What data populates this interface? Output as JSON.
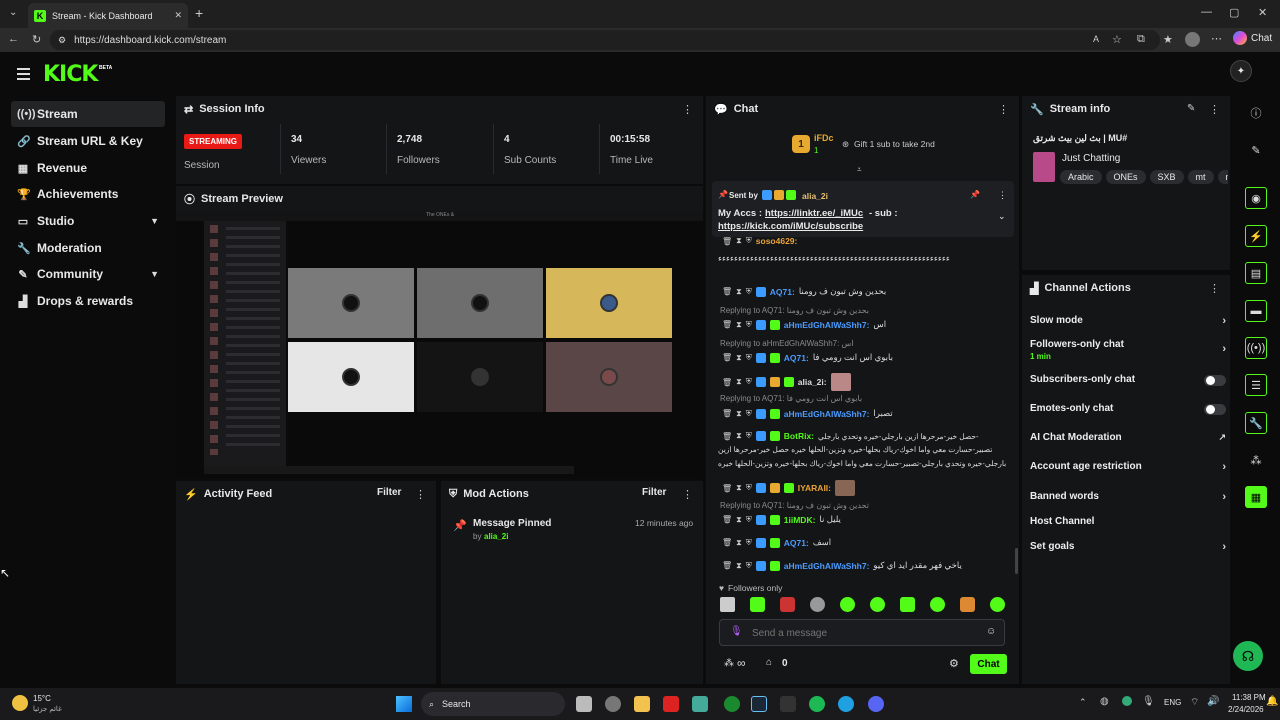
{
  "browser": {
    "tab_title": "Stream - Kick Dashboard",
    "url": "https://dashboard.kick.com/stream",
    "chat_button": "Chat"
  },
  "app": {
    "logo": "KICK",
    "beta": "BETA"
  },
  "sidebar": {
    "items": [
      {
        "label": "Stream",
        "icon": "stream-icon"
      },
      {
        "label": "Stream URL & Key",
        "icon": "link-icon"
      },
      {
        "label": "Revenue",
        "icon": "revenue-icon"
      },
      {
        "label": "Achievements",
        "icon": "trophy-icon"
      },
      {
        "label": "Studio",
        "icon": "studio-icon"
      },
      {
        "label": "Moderation",
        "icon": "wrench-icon"
      },
      {
        "label": "Community",
        "icon": "community-icon"
      },
      {
        "label": "Drops & rewards",
        "icon": "drops-icon"
      }
    ]
  },
  "session": {
    "title": "Session Info",
    "status": "STREAMING",
    "status_label": "Session",
    "stats": [
      {
        "value": "34",
        "label": "Viewers"
      },
      {
        "value": "2,748",
        "label": "Followers"
      },
      {
        "value": "4",
        "label": "Sub Counts"
      },
      {
        "value": "00:15:58",
        "label": "Time Live"
      }
    ]
  },
  "preview": {
    "title": "Stream Preview",
    "window_title": "The ONEs &"
  },
  "activity": {
    "title": "Activity Feed",
    "filter": "Filter"
  },
  "mod": {
    "title": "Mod Actions",
    "filter": "Filter",
    "entry_title": "Message Pinned",
    "entry_by": "by",
    "entry_user": "alia_2i",
    "entry_time": "12 minutes ago"
  },
  "chat": {
    "title": "Chat",
    "top_gifter": "iFDc",
    "top_gifter_rank": "1",
    "top_gifter_count": "1",
    "gift_text": "Gift 1 sub to take 2nd",
    "pinned_sent_by": "Sent by",
    "pinned_user": "alia_2i",
    "pinned_text": "My Accs :",
    "pinned_link1": "https://linktr.ee/_iMUc",
    "pinned_sub": "- sub :",
    "pinned_link2": "https://kick.com/iMUc/subscribe",
    "messages": [
      {
        "user": "soso4629:",
        "text": "",
        "color": "#e8a33a"
      },
      {
        "user": "",
        "text": "ﺀﺀﺀﺀﺀﺀﺀﺀﺀﺀﺀﺀﺀﺀﺀﺀﺀﺀﺀﺀﺀﺀﺀﺀﺀﺀﺀﺀﺀﺀﺀﺀﺀﺀﺀﺀﺀﺀﺀﺀﺀﺀﺀﺀﺀﺀﺀﺀﺀﺀﺀﺀﺀﺀﺀﺀﺀﺀ",
        "color": "#ddd"
      },
      {
        "user": "AQ71:",
        "text": "بحدين وش تبون ف رومنا",
        "color": "#4a9cff"
      },
      {
        "user": "aHmEdGhAlWaShh7:",
        "text": "اس",
        "color": "#4a9cff"
      },
      {
        "user": "AQ71:",
        "text": "بابوي اس انت رومي فا",
        "color": "#4a9cff"
      },
      {
        "user": "alia_2i:",
        "text": "",
        "color": "#ddd"
      },
      {
        "user": "aHmEdGhAlWaShh7:",
        "text": "تصبرا",
        "color": "#4a9cff"
      },
      {
        "user": "BotRix:",
        "text": "حصل خير-مرحرها ازين بارجلي-خيره وتحدي بارجلي-",
        "color": "#53fc18"
      },
      {
        "user": "",
        "text": "تصبير-حسارت معي واما اخوك-رياك بحلها-خيره وتزين-الحلها خيره حصل خير-مرحرها ازين",
        "color": "#ddd"
      },
      {
        "user": "",
        "text": "بارجلي-خيره وتحدي بارجلي-تصبير-حسارت معي واما اخوك-رياك بحلها-خيره وتزين-الحلها خيره",
        "color": "#ddd"
      },
      {
        "user": "IYARAII:",
        "text": "",
        "color": "#e8a33a"
      },
      {
        "user": "1iiMDK:",
        "text": "يليل نا",
        "color": "#53fc18"
      },
      {
        "user": "AQ71:",
        "text": "اسف",
        "color": "#4a9cff"
      },
      {
        "user": "aHmEdGhAlWaShh7:",
        "text": "ياخي فهر مقدر ايد اي كيو",
        "color": "#4a9cff"
      }
    ],
    "replies": [
      {
        "text": "Replying to AQ71: بحدين وش تبون ف رومنا"
      },
      {
        "text": "Replying to aHmEdGhAlWaShh7: اس"
      },
      {
        "text": "Replying to AQ71: بابوي اس انت رومي فا"
      },
      {
        "text": "Replying to AQ71: تحدين وش تبون ف رومنا"
      }
    ],
    "followers_only": "Followers only",
    "input_placeholder": "Send a message",
    "points": "0",
    "send": "Chat"
  },
  "stream_info": {
    "title": "Stream info",
    "stream_title": "بث لين بيث شرتق | MU#",
    "category": "Just Chatting",
    "tags": [
      "Arabic",
      "ONEs",
      "SXB",
      "mt",
      "m"
    ]
  },
  "channel_actions": {
    "title": "Channel Actions",
    "items": [
      {
        "label": "Slow mode",
        "type": "chevron"
      },
      {
        "label": "Followers-only chat",
        "sub": "1 min",
        "type": "chevron"
      },
      {
        "label": "Subscribers-only chat",
        "type": "toggle"
      },
      {
        "label": "Emotes-only chat",
        "type": "toggle"
      },
      {
        "label": "AI Chat Moderation",
        "type": "external"
      },
      {
        "label": "Account age restriction",
        "type": "chevron"
      },
      {
        "label": "Banned words",
        "type": "chevron"
      },
      {
        "label": "Host Channel",
        "type": "none"
      },
      {
        "label": "Set goals",
        "type": "chevron"
      }
    ]
  },
  "taskbar": {
    "weather_temp": "15°C",
    "weather_text": "غائم جزئيا",
    "search": "Search",
    "lang": "ENG",
    "time": "11:38 PM",
    "date": "2/24/2026"
  },
  "colors": {
    "accent": "#53fc18",
    "live": "#e91916",
    "panel": "#141517"
  }
}
